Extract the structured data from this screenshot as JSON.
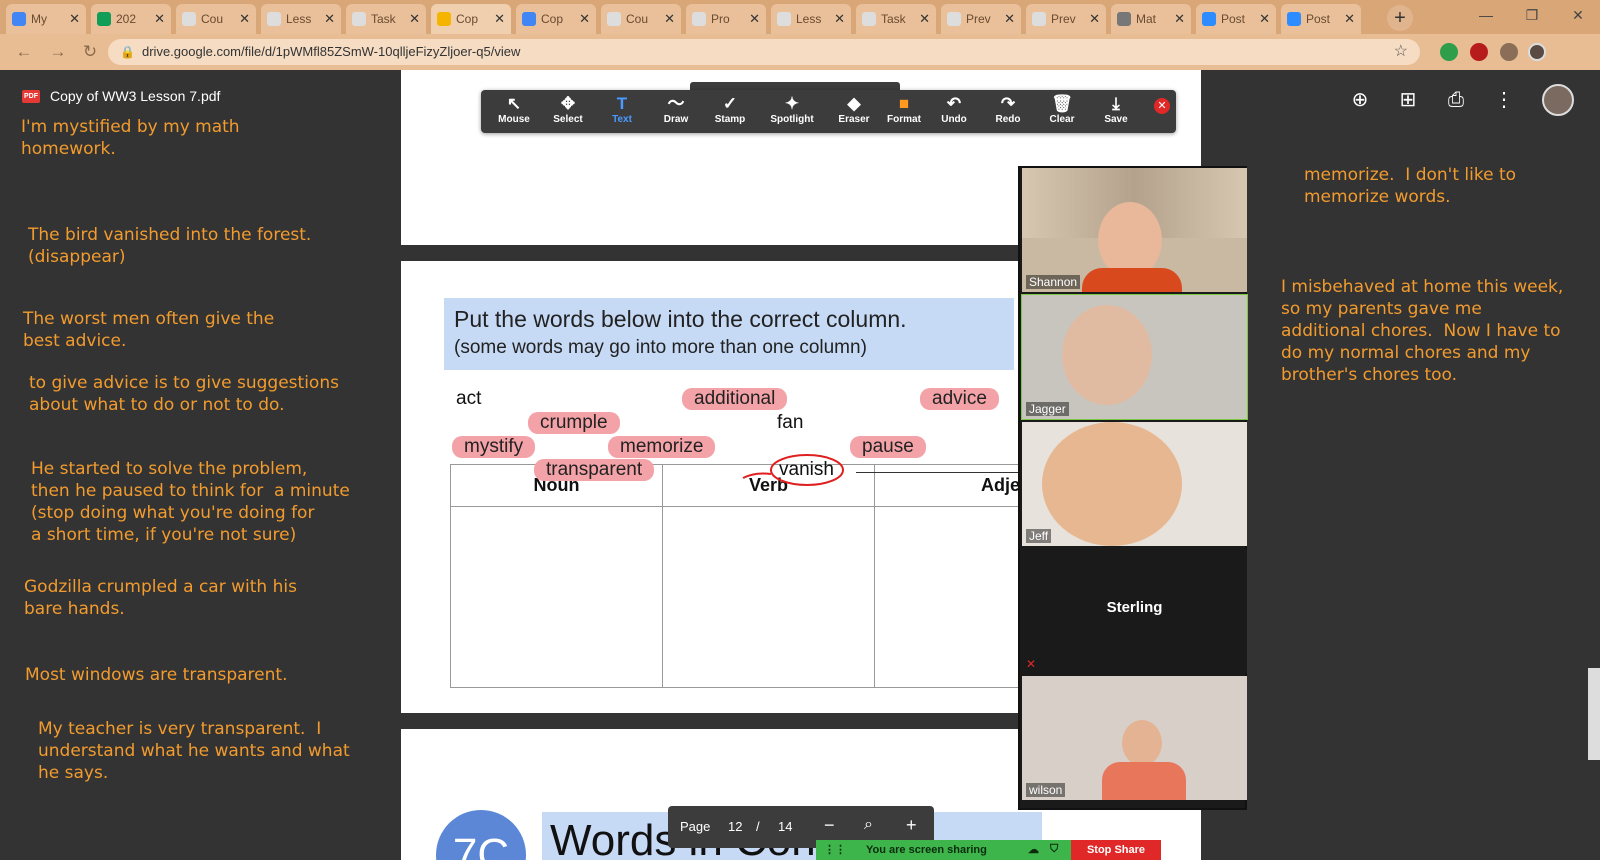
{
  "tabs": [
    {
      "label": "My",
      "color": "#4285f4",
      "active": false
    },
    {
      "label": "202",
      "color": "#0f9d58",
      "active": false
    },
    {
      "label": "Cou",
      "color": "#dddddd",
      "active": false
    },
    {
      "label": "Less",
      "color": "#dddddd",
      "active": false
    },
    {
      "label": "Task",
      "color": "#dddddd",
      "active": false
    },
    {
      "label": "Cop",
      "color": "#f4b400",
      "active": true
    },
    {
      "label": "Cop",
      "color": "#4285f4",
      "active": false
    },
    {
      "label": "Cou",
      "color": "#dddddd",
      "active": false
    },
    {
      "label": "Pro",
      "color": "#dddddd",
      "active": false
    },
    {
      "label": "Less",
      "color": "#dddddd",
      "active": false
    },
    {
      "label": "Task",
      "color": "#dddddd",
      "active": false
    },
    {
      "label": "Prev",
      "color": "#dddddd",
      "active": false
    },
    {
      "label": "Prev",
      "color": "#dddddd",
      "active": false
    },
    {
      "label": "Mat",
      "color": "#777777",
      "active": false
    },
    {
      "label": "Post",
      "color": "#2d8cff",
      "active": false
    },
    {
      "label": "Post",
      "color": "#2d8cff",
      "active": false
    }
  ],
  "address": {
    "url": "drive.google.com/file/d/1pWMfl85ZSmW-10qlljeFizyZljoer-q5/view"
  },
  "viewer": {
    "file_name": "Copy of WW3 Lesson 7.pdf",
    "pdf_badge": "PDF"
  },
  "notes_left": [
    "I'm mystified by my math\nhomework.",
    "The bird vanished into the forest.\n(disappear)",
    "The worst men often give the\nbest advice.",
    "to give advice is to give suggestions\nabout what to do or not to do.",
    "He started to solve the problem,\nthen he paused to think for  a minute\n(stop doing what you're doing for\na short time, if you're not sure)",
    "Godzilla crumpled a car with his\nbare hands.",
    "Most windows are transparent.",
    "My teacher is very transparent.  I\nunderstand what he wants and what\nhe says."
  ],
  "notes_right": [
    "memorize.  I don't like to\nmemorize words.",
    "I misbehaved at home this week,\nso my parents gave me\nadditional chores.  Now I have to\ndo my normal chores and my\nbrother's chores too."
  ],
  "worksheet": {
    "instruction_main": "Put the words below into the correct column.",
    "instruction_sub": "(some words may go into more than one column)",
    "words": {
      "act": "act",
      "additional": "additional",
      "advice": "advice",
      "crumple": "crumple",
      "fan": "fan",
      "mystify": "mystify",
      "memorize": "memorize",
      "pause": "pause",
      "transparent": "transparent",
      "vanish": "vanish"
    },
    "columns": [
      "Noun",
      "Verb",
      "Adjective"
    ],
    "next_section_number": "7C",
    "next_section_title": "Words in Context"
  },
  "zoom_toolbar": [
    {
      "label": "Mouse",
      "icon": "↖"
    },
    {
      "label": "Select",
      "icon": "✥"
    },
    {
      "label": "Text",
      "icon": "T"
    },
    {
      "label": "Draw",
      "icon": "〜"
    },
    {
      "label": "Stamp",
      "icon": "✓"
    },
    {
      "label": "Spotlight",
      "icon": "✦"
    },
    {
      "label": "Eraser",
      "icon": "◆"
    },
    {
      "label": "Format",
      "icon": "■"
    },
    {
      "label": "Undo",
      "icon": "↶"
    },
    {
      "label": "Redo",
      "icon": "↷"
    },
    {
      "label": "Clear",
      "icon": "🗑"
    },
    {
      "label": "Save",
      "icon": "⤓"
    }
  ],
  "participants": [
    {
      "name": "Shannon"
    },
    {
      "name": "Jagger"
    },
    {
      "name": "Jeff"
    },
    {
      "name": "Sterling"
    },
    {
      "name": "wilson"
    }
  ],
  "page_nav": {
    "label": "Page",
    "current": "12",
    "separator": "/",
    "total": "14",
    "zoom_out": "−",
    "zoom_in": "+"
  },
  "share_bar": {
    "status": "You are screen sharing",
    "stop": "Stop Share"
  },
  "colors": {
    "note_orange": "#f29b2e",
    "highlight_pink": "#f3a3a8",
    "zoom_blue": "#2d8cff",
    "stop_red": "#e02828",
    "share_green": "#3db54a"
  }
}
